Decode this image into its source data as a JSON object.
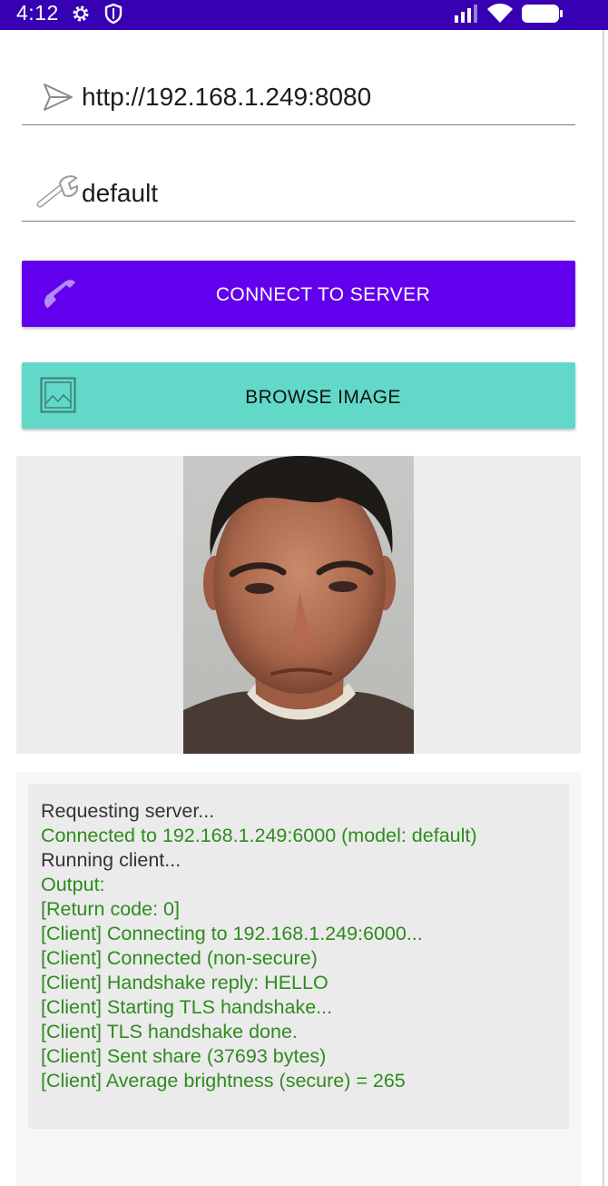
{
  "status_bar": {
    "time": "4:12",
    "left_icons": [
      "gear-icon",
      "shield-icon"
    ],
    "right_icons": [
      "signal-icon",
      "wifi-icon",
      "battery-icon"
    ],
    "background": "#3700b3"
  },
  "form": {
    "server_url": {
      "icon": "send-icon",
      "value": "http://192.168.1.249:8080"
    },
    "model": {
      "icon": "wrench-icon",
      "value": "default"
    }
  },
  "buttons": {
    "connect": {
      "label": "CONNECT TO SERVER",
      "icon": "phone-icon",
      "color": "#6200ee"
    },
    "browse": {
      "label": "BROWSE IMAGE",
      "icon": "image-icon",
      "color": "#62d9c8"
    }
  },
  "image_preview": {
    "subject": "portrait photo of a middle-aged man"
  },
  "log": {
    "lines": [
      {
        "text": "Requesting server...",
        "color": "#333333"
      },
      {
        "text": "Connected to 192.168.1.249:6000 (model: default)",
        "color": "#2e8b1e"
      },
      {
        "text": "Running client...",
        "color": "#333333"
      },
      {
        "text": "Output:",
        "color": "#2e8b1e"
      },
      {
        "text": "[Return code: 0]",
        "color": "#2e8b1e"
      },
      {
        "text": "[Client] Connecting to 192.168.1.249:6000...",
        "color": "#2e8b1e"
      },
      {
        "text": "[Client] Connected (non-secure)",
        "color": "#2e8b1e"
      },
      {
        "text": "[Client] Handshake reply: HELLO",
        "color": "#2e8b1e"
      },
      {
        "text": "[Client] Starting TLS handshake...",
        "color": "#2e8b1e"
      },
      {
        "text": "[Client] TLS handshake done.",
        "color": "#2e8b1e"
      },
      {
        "text": "[Client] Sent share (37693 bytes)",
        "color": "#2e8b1e"
      },
      {
        "text": "[Client] Average brightness (secure) = 265",
        "color": "#2e8b1e"
      }
    ]
  }
}
